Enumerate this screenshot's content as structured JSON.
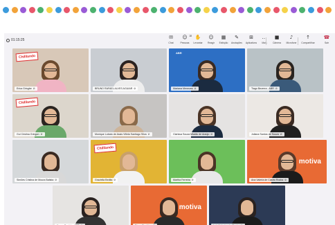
{
  "top_dots": [
    "#3c9bdc",
    "#f2a33a",
    "#9a5bd6",
    "#e8576b",
    "#4cb26f",
    "#f5d24a",
    "#3c9bdc",
    "#e8576b",
    "#f2a33a",
    "#9a5bd6",
    "#4cb26f",
    "#3c9bdc",
    "#e8576b",
    "#f5d24a",
    "#9a5bd6",
    "#f2a33a",
    "#e8576b",
    "#4cb26f",
    "#3c9bdc",
    "#f2a33a",
    "#e8576b",
    "#9a5bd6",
    "#4cb26f",
    "#f5d24a",
    "#3c9bdc",
    "#e8576b",
    "#f2a33a",
    "#9a5bd6",
    "#4cb26f",
    "#3c9bdc",
    "#f2a33a",
    "#e8576b",
    "#f5d24a",
    "#9a5bd6",
    "#4cb26f",
    "#3c9bdc",
    "#e8576b",
    "#f2a33a"
  ],
  "meeting": {
    "elapsed": "01:15:25"
  },
  "toolbar": {
    "items": [
      {
        "name": "chat",
        "icon": "chat-icon",
        "label": "Chat"
      },
      {
        "name": "people",
        "icon": "people-icon",
        "label": "Pessoas",
        "badge": "18"
      },
      {
        "name": "raise",
        "icon": "raise-hand-icon",
        "label": "Levantar"
      },
      {
        "name": "react",
        "icon": "react-icon",
        "label": "Reagir"
      },
      {
        "name": "view",
        "icon": "view-icon",
        "label": "Exibição"
      },
      {
        "name": "notes",
        "icon": "notes-icon",
        "label": "Anotações"
      },
      {
        "name": "apps",
        "icon": "apps-icon",
        "label": "Aplicativos"
      },
      {
        "name": "more",
        "icon": "more-icon",
        "label": "Mais"
      },
      {
        "name": "camera",
        "icon": "camera-icon",
        "label": "Câmera"
      },
      {
        "name": "mic",
        "icon": "microphone-icon",
        "label": "Microfone"
      },
      {
        "name": "share",
        "icon": "share-icon",
        "label": "Compartilhar"
      },
      {
        "name": "leave",
        "icon": "leave-icon",
        "label": "Sair"
      }
    ]
  },
  "participants": [
    {
      "name": "Erica Grisgbe",
      "bg": "#d8c8b8",
      "sign": "Chilllando"
    },
    {
      "name": "BRUNO RAFAEL ALVES AGUIAR",
      "bg": "#c9cdd2"
    },
    {
      "name": "Mariana Menezes",
      "bg": "#2d6fc4",
      "logo": "ABR"
    },
    {
      "name": "Tiago Bezerra - ABR",
      "bg": "#b9c2c6"
    },
    {
      "name": "Gui Cristina Gringon",
      "bg": "#dcd6cc",
      "sign": "Chilllando"
    },
    {
      "name": "Monique Lobato de Assis Villela Santiago Silva",
      "bg": "#c6c4c2"
    },
    {
      "name": "Clarissa Souza Miarão de Araújo",
      "bg": "#e5e3e2"
    },
    {
      "name": "Juliana Santos de Souza",
      "bg": "#ece8e4"
    },
    {
      "name": "Simões Cristina de Moura Batista",
      "bg": "#d5d8da"
    },
    {
      "name": "Graziella Bedita",
      "bg": "#e2b434",
      "sign": "Chilllando"
    },
    {
      "name": "Martha Ferreira",
      "bg": "#6cbf5a"
    },
    {
      "name": "Ana Valeria de Castro Rocha",
      "bg": "#e86a34",
      "logo": "motiva"
    },
    {
      "name": "Karen Cordeiro ABR",
      "bg": "#e6e4e2"
    },
    {
      "name": "Diego Bastidas",
      "bg": "#e86a34",
      "logo": "motiva"
    },
    {
      "name": "Luiz Valentes de Castro",
      "bg": "#2c3a55"
    }
  ]
}
